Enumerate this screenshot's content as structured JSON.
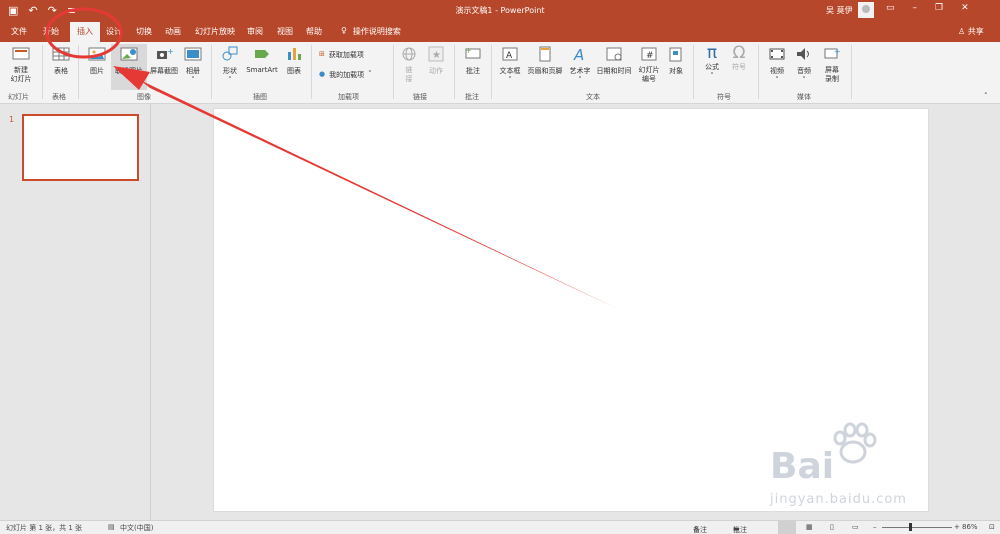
{
  "titlebar": {
    "title": "演示文稿1 - PowerPoint",
    "user": "吴 莫伊",
    "qat_icons": [
      "save-icon",
      "undo-icon",
      "redo-icon",
      "customize-qat-icon"
    ],
    "window_controls": [
      "ribbon-display-icon",
      "minimize-icon",
      "restore-icon",
      "close-icon"
    ]
  },
  "tabs": {
    "file": "文件",
    "home": "开始",
    "insert": "插入",
    "design": "设计",
    "transitions": "切换",
    "animations": "动画",
    "slideshow": "幻灯片放映",
    "review": "审阅",
    "view": "视图",
    "help": "帮助",
    "tellme": "操作说明搜索",
    "share": "共享"
  },
  "ribbon": {
    "new_slide": "新建\n幻灯片",
    "table": "表格",
    "picture": "图片",
    "online_picture": "联机图片",
    "screenshot": "屏幕截图",
    "album": "相册",
    "shapes": "形状",
    "smartart": "SmartArt",
    "chart": "图表",
    "get_addins": "获取加载项",
    "my_addins": "我的加载项",
    "link": "链接",
    "action": "动作",
    "comment": "批注",
    "textbox": "文本框",
    "header_footer": "页眉和页脚",
    "wordart": "艺术字",
    "datetime": "日期和时间",
    "slide_number": "幻灯片\n编号",
    "object": "对象",
    "equation": "公式",
    "symbol": "符号",
    "video": "视频",
    "audio": "音频",
    "screen_recording": "屏幕\n录制",
    "groups": {
      "slides": "幻灯片",
      "tables": "表格",
      "images": "图像",
      "illustrations": "插图",
      "addins": "加载项",
      "links": "链接",
      "comments": "批注",
      "text": "文本",
      "symbols": "符号",
      "media": "媒体"
    }
  },
  "thumbnails": [
    {
      "number": "1"
    }
  ],
  "status": {
    "slide_info": "幻灯片 第 1 张，共 1 张",
    "language": "中文(中国)",
    "notes": "备注",
    "comments": "批注",
    "zoom": "86%"
  },
  "watermark": {
    "brand": "Bai",
    "url": "jingyan.baidu.com"
  },
  "colors": {
    "accent": "#b7472a",
    "annotation": "#e53935"
  }
}
